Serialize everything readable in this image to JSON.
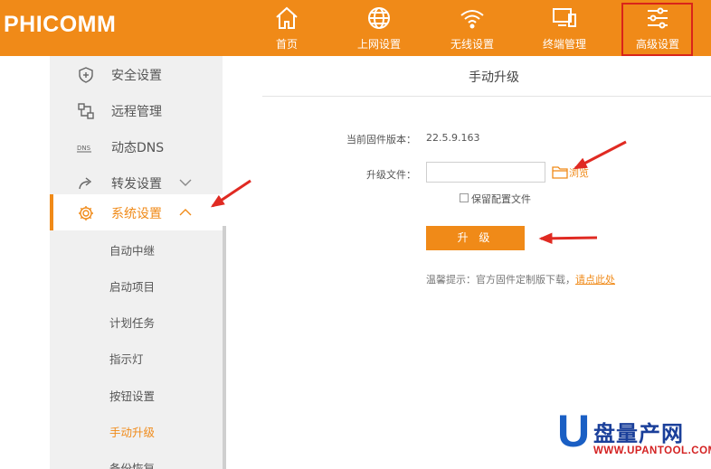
{
  "header": {
    "logo": "PHICOMM",
    "nav": [
      {
        "label": "首页",
        "icon": "home-icon"
      },
      {
        "label": "上网设置",
        "icon": "globe-icon"
      },
      {
        "label": "无线设置",
        "icon": "wifi-icon"
      },
      {
        "label": "终端管理",
        "icon": "devices-icon"
      },
      {
        "label": "高级设置",
        "icon": "sliders-icon",
        "active": true
      }
    ]
  },
  "sidebar": {
    "items": [
      {
        "label": "安全设置",
        "icon": "shield-icon"
      },
      {
        "label": "远程管理",
        "icon": "remote-icon"
      },
      {
        "label": "动态DNS",
        "icon": "dns-icon"
      },
      {
        "label": "转发设置",
        "icon": "forward-icon",
        "expandable": true
      },
      {
        "label": "系统设置",
        "icon": "gear-icon",
        "expanded": true,
        "active": true
      }
    ],
    "sub_items": [
      "自动中继",
      "启动项目",
      "计划任务",
      "指示灯",
      "按钮设置",
      "手动升级",
      "备份恢复"
    ],
    "active_sub": "手动升级"
  },
  "content": {
    "title": "手动升级",
    "firmware_label": "当前固件版本：",
    "firmware_value": "22.5.9.163",
    "file_label": "升级文件：",
    "file_value": "",
    "browse_label": "浏览",
    "keep_config_label": "保留配置文件",
    "keep_config_checked": false,
    "upgrade_button": "升 级",
    "hint_text": "温馨提示：官方固件定制版下载，",
    "hint_link": "请点此处"
  },
  "watermark": {
    "letter": "U",
    "name": "盘量产网",
    "url": "WWW.UPANTOOL.COM"
  },
  "colors": {
    "accent": "#f08a18",
    "highlight_box": "#d9241a",
    "arrow": "#e02a22"
  }
}
